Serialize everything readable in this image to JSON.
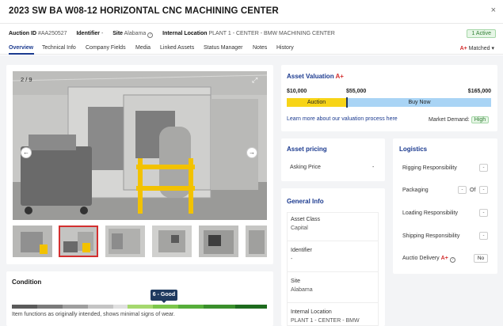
{
  "header": {
    "title": "2023 SW BA W08-12 HORIZONTAL CNC MACHINING CENTER",
    "close_label": "×"
  },
  "meta": {
    "auction_id_label": "Auction ID",
    "auction_id_value": "#AA250527",
    "identifier_label": "Identifier",
    "identifier_value": "-",
    "site_label": "Site",
    "site_value": "Alabama",
    "internal_location_label": "Internal Location",
    "internal_location_value": "PLANT 1 - CENTER - BMW MACHINING CENTER",
    "status_badge": "1 Active"
  },
  "tabs": {
    "items": [
      "Overview",
      "Technical Info",
      "Company Fields",
      "Media",
      "Linked Assets",
      "Status Manager",
      "Notes",
      "History"
    ],
    "active": "Overview",
    "matched_prefix": "A+",
    "matched_label": "Matched",
    "matched_chevron": "▾"
  },
  "gallery": {
    "counter": "2 / 9",
    "expand_icon": "⤢",
    "prev_icon": "←",
    "next_icon": "→"
  },
  "condition": {
    "title": "Condition",
    "rating": "6 - Good",
    "rating_value": 6,
    "rating_max": 10,
    "description": "Item functions as originally intended, shows minimal signs of wear."
  },
  "valuation": {
    "title": "Asset Valuation",
    "title_badge": "A+",
    "low": "$10,000",
    "mid": "$55,000",
    "high": "$165,000",
    "auction_label": "Auction",
    "buy_now_label": "Buy Now",
    "learn_more": "Learn more about our valuation process here",
    "demand_label": "Market Demand:",
    "demand_value": "High"
  },
  "pricing": {
    "title": "Asset pricing",
    "asking_price_label": "Asking Price",
    "asking_price_value": "-"
  },
  "general_info": {
    "title": "General Info",
    "asset_class_label": "Asset Class",
    "asset_class_value": "Capital",
    "identifier_label": "Identifier",
    "identifier_value": "-",
    "site_label": "Site",
    "site_value": "Alabama",
    "internal_location_label": "Internal Location",
    "internal_location_value": "PLANT 1 - CENTER - BMW"
  },
  "logistics": {
    "title": "Logistics",
    "rigging_label": "Rigging Responsibility",
    "rigging_value": "-",
    "packaging_label": "Packaging",
    "packaging_value": "-",
    "packaging_of": "Of",
    "packaging_value2": "-",
    "loading_label": "Loading Responsibility",
    "loading_value": "-",
    "shipping_label": "Shipping Responsibility",
    "shipping_value": "-",
    "delivery_label": "Auctio Delivery",
    "delivery_badge": "A+",
    "delivery_value": "No"
  },
  "colors": {
    "accent": "#1b3a8f",
    "auction_yellow": "#f7d417",
    "buy_now_blue": "#a9d4f5",
    "brand_red": "#d32f2f"
  }
}
